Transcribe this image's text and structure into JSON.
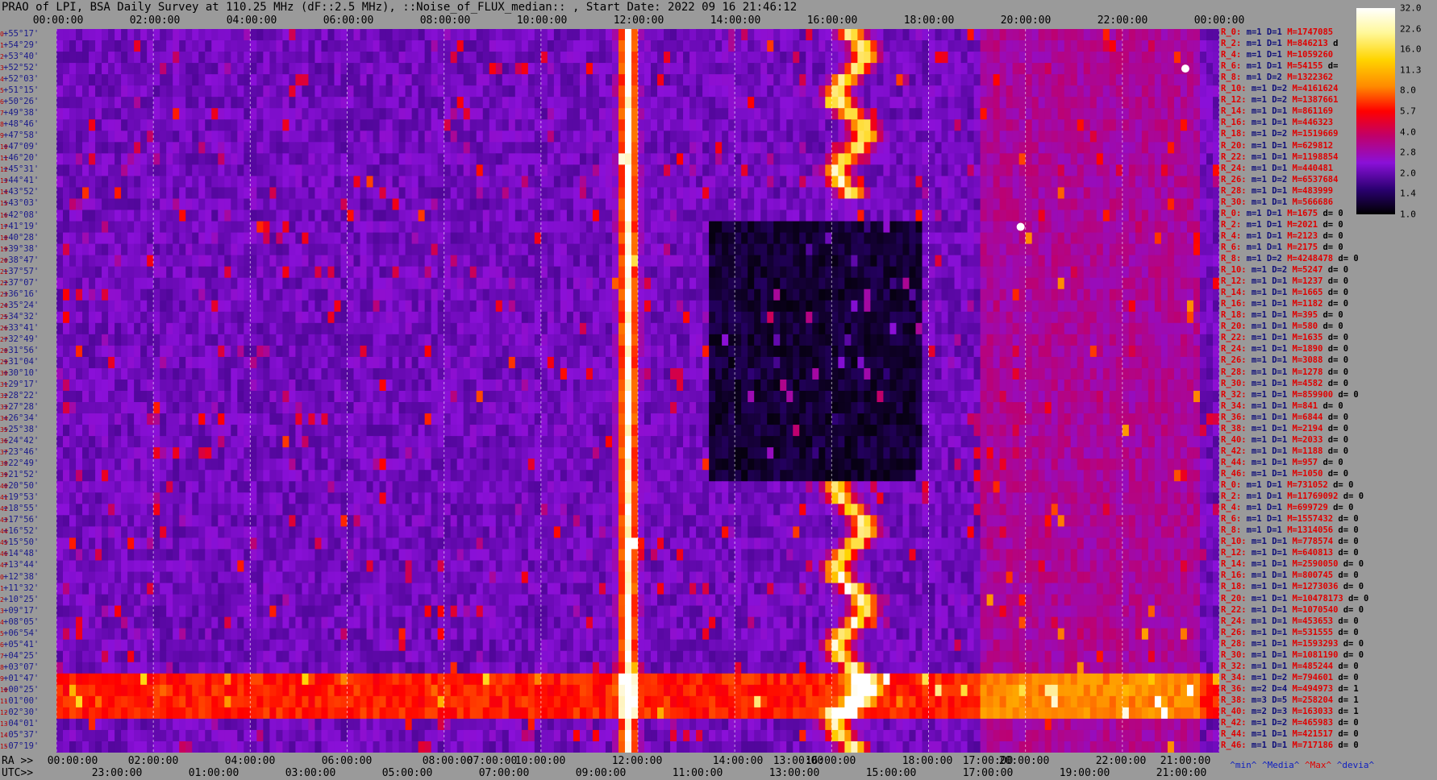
{
  "title": "PRAO of LPI, BSA Daily Survey at 110.25 MHz (dF::2.5 MHz), ::Noise_of_FLUX_median:: , Start Date: 2022 09 16 21:46:12",
  "top_ticks": [
    "00:00:00",
    "02:00:00",
    "04:00:00",
    "06:00:00",
    "08:00:00",
    "10:00:00",
    "12:00:00",
    "14:00:00",
    "16:00:00",
    "18:00:00",
    "20:00:00",
    "22:00:00",
    "00:00:00"
  ],
  "ra_label": "RA >>",
  "ra_ticks": [
    "00:00:00",
    "02:00:00",
    "04:00:00",
    "06:00:00",
    "08:00:00",
    "07:00:00",
    "10:00:00",
    "12:00:00",
    "14:00:00",
    "13:00:00",
    "16:00:00",
    "18:00:00",
    "17:00:00",
    "20:00:00",
    "22:00:00",
    "21:00:00"
  ],
  "utc_label": "UTC>>",
  "utc_ticks": [
    "23:00:00",
    "01:00:00",
    "03:00:00",
    "05:00:00",
    "07:00:00",
    "09:00:00",
    "11:00:00",
    "13:00:00",
    "15:00:00",
    "17:00:00",
    "19:00:00",
    "21:00:00"
  ],
  "dec_labels": [
    "+55°17'",
    "+54°29'",
    "+53°40'",
    "+52°52'",
    "+52°03'",
    "+51°15'",
    "+50°26'",
    "+49°38'",
    "+48°46'",
    "+47°58'",
    "+47°09'",
    "+46°20'",
    "+45°31'",
    "+44°41'",
    "+43°52'",
    "+43°03'",
    "+42°08'",
    "+41°19'",
    "+40°28'",
    "+39°38'",
    "+38°47'",
    "+37°57'",
    "+37°07'",
    "+36°16'",
    "+35°24'",
    "+34°32'",
    "+33°41'",
    "+32°49'",
    "+31°56'",
    "+31°04'",
    "+30°10'",
    "+29°17'",
    "+28°22'",
    "+27°28'",
    "+26°34'",
    "+25°38'",
    "+24°42'",
    "+23°46'",
    "+22°49'",
    "+21°52'",
    "+20°50'",
    "+19°53'",
    "+18°55'",
    "+17°56'",
    "+16°52'",
    "+15°50'",
    "+14°48'",
    "+13°44'",
    "+12°38'",
    "+11°32'",
    "+10°25'",
    "+09°17'",
    "+08°05'",
    "+06°54'",
    "+05°41'",
    "+04°25'",
    "+03°07'",
    "+01°47'",
    "+00°25'",
    "-01°00'",
    "-02°30'",
    "-04°01'",
    "-05°37'",
    "-07°19'"
  ],
  "stats": [
    {
      "r": "R_0:",
      "m": "m=1",
      "d": "D=1",
      "M": "M=1747085",
      "e": ""
    },
    {
      "r": "R_2:",
      "m": "m=1",
      "d": "D=1",
      "M": "M=846213",
      "e": "d"
    },
    {
      "r": "R_4:",
      "m": "m=1",
      "d": "D=1",
      "M": "M=1059260",
      "e": ""
    },
    {
      "r": "R_6:",
      "m": "m=1",
      "d": "D=1",
      "M": "M=54155",
      "e": "d="
    },
    {
      "r": "R_8:",
      "m": "m=1",
      "d": "D=2",
      "M": "M=1322362",
      "e": ""
    },
    {
      "r": "R_10:",
      "m": "m=1",
      "d": "D=2",
      "M": "M=4161624",
      "e": ""
    },
    {
      "r": "R_12:",
      "m": "m=1",
      "d": "D=2",
      "M": "M=1387661",
      "e": ""
    },
    {
      "r": "R_14:",
      "m": "m=1",
      "d": "D=1",
      "M": "M=861169",
      "e": ""
    },
    {
      "r": "R_16:",
      "m": "m=1",
      "d": "D=1",
      "M": "M=446323",
      "e": ""
    },
    {
      "r": "R_18:",
      "m": "m=1",
      "d": "D=2",
      "M": "M=1519669",
      "e": ""
    },
    {
      "r": "R_20:",
      "m": "m=1",
      "d": "D=1",
      "M": "M=629812",
      "e": ""
    },
    {
      "r": "R_22:",
      "m": "m=1",
      "d": "D=1",
      "M": "M=1198854",
      "e": ""
    },
    {
      "r": "R_24:",
      "m": "m=1",
      "d": "D=1",
      "M": "M=440481",
      "e": ""
    },
    {
      "r": "R_26:",
      "m": "m=1",
      "d": "D=2",
      "M": "M=6537684",
      "e": ""
    },
    {
      "r": "R_28:",
      "m": "m=1",
      "d": "D=1",
      "M": "M=483999",
      "e": ""
    },
    {
      "r": "R_30:",
      "m": "m=1",
      "d": "D=1",
      "M": "M=566686",
      "e": ""
    },
    {
      "r": "R_0:",
      "m": "m=1",
      "d": "D=1",
      "M": "M=1675",
      "e": "d= 0"
    },
    {
      "r": "R_2:",
      "m": "m=1",
      "d": "D=1",
      "M": "M=2021",
      "e": "d= 0"
    },
    {
      "r": "R_4:",
      "m": "m=1",
      "d": "D=1",
      "M": "M=2123",
      "e": "d= 0"
    },
    {
      "r": "R_6:",
      "m": "m=1",
      "d": "D=1",
      "M": "M=2175",
      "e": "d= 0"
    },
    {
      "r": "R_8:",
      "m": "m=1",
      "d": "D=2",
      "M": "M=4248478",
      "e": "d= 0"
    },
    {
      "r": "R_10:",
      "m": "m=1",
      "d": "D=2",
      "M": "M=5247",
      "e": "d= 0"
    },
    {
      "r": "R_12:",
      "m": "m=1",
      "d": "D=1",
      "M": "M=1237",
      "e": "d= 0"
    },
    {
      "r": "R_14:",
      "m": "m=1",
      "d": "D=1",
      "M": "M=1665",
      "e": "d= 0"
    },
    {
      "r": "R_16:",
      "m": "m=1",
      "d": "D=1",
      "M": "M=1182",
      "e": "d= 0"
    },
    {
      "r": "R_18:",
      "m": "m=1",
      "d": "D=1",
      "M": "M=395",
      "e": "d= 0"
    },
    {
      "r": "R_20:",
      "m": "m=1",
      "d": "D=1",
      "M": "M=580",
      "e": "d= 0"
    },
    {
      "r": "R_22:",
      "m": "m=1",
      "d": "D=1",
      "M": "M=1635",
      "e": "d= 0"
    },
    {
      "r": "R_24:",
      "m": "m=1",
      "d": "D=1",
      "M": "M=1890",
      "e": "d= 0"
    },
    {
      "r": "R_26:",
      "m": "m=1",
      "d": "D=1",
      "M": "M=3088",
      "e": "d= 0"
    },
    {
      "r": "R_28:",
      "m": "m=1",
      "d": "D=1",
      "M": "M=1278",
      "e": "d= 0"
    },
    {
      "r": "R_30:",
      "m": "m=1",
      "d": "D=1",
      "M": "M=4582",
      "e": "d= 0"
    },
    {
      "r": "R_32:",
      "m": "m=1",
      "d": "D=1",
      "M": "M=859900",
      "e": "d= 0"
    },
    {
      "r": "R_34:",
      "m": "m=1",
      "d": "D=1",
      "M": "M=841",
      "e": "d= 0"
    },
    {
      "r": "R_36:",
      "m": "m=1",
      "d": "D=1",
      "M": "M=6844",
      "e": "d= 0"
    },
    {
      "r": "R_38:",
      "m": "m=1",
      "d": "D=1",
      "M": "M=2194",
      "e": "d= 0"
    },
    {
      "r": "R_40:",
      "m": "m=1",
      "d": "D=1",
      "M": "M=2033",
      "e": "d= 0"
    },
    {
      "r": "R_42:",
      "m": "m=1",
      "d": "D=1",
      "M": "M=1188",
      "e": "d= 0"
    },
    {
      "r": "R_44:",
      "m": "m=1",
      "d": "D=1",
      "M": "M=957",
      "e": "d= 0"
    },
    {
      "r": "R_46:",
      "m": "m=1",
      "d": "D=1",
      "M": "M=1050",
      "e": "d= 0"
    },
    {
      "r": "R_0:",
      "m": "m=1",
      "d": "D=1",
      "M": "M=731052",
      "e": "d= 0"
    },
    {
      "r": "R_2:",
      "m": "m=1",
      "d": "D=1",
      "M": "M=11769092",
      "e": "d= 0"
    },
    {
      "r": "R_4:",
      "m": "m=1",
      "d": "D=1",
      "M": "M=699729",
      "e": "d= 0"
    },
    {
      "r": "R_6:",
      "m": "m=1",
      "d": "D=1",
      "M": "M=1557432",
      "e": "d= 0"
    },
    {
      "r": "R_8:",
      "m": "m=1",
      "d": "D=1",
      "M": "M=1314056",
      "e": "d= 0"
    },
    {
      "r": "R_10:",
      "m": "m=1",
      "d": "D=1",
      "M": "M=778574",
      "e": "d= 0"
    },
    {
      "r": "R_12:",
      "m": "m=1",
      "d": "D=1",
      "M": "M=640813",
      "e": "d= 0"
    },
    {
      "r": "R_14:",
      "m": "m=1",
      "d": "D=1",
      "M": "M=2590050",
      "e": "d= 0"
    },
    {
      "r": "R_16:",
      "m": "m=1",
      "d": "D=1",
      "M": "M=800745",
      "e": "d= 0"
    },
    {
      "r": "R_18:",
      "m": "m=1",
      "d": "D=1",
      "M": "M=1273036",
      "e": "d= 0"
    },
    {
      "r": "R_20:",
      "m": "m=1",
      "d": "D=1",
      "M": "M=10478173",
      "e": "d= 0"
    },
    {
      "r": "R_22:",
      "m": "m=1",
      "d": "D=1",
      "M": "M=1070540",
      "e": "d= 0"
    },
    {
      "r": "R_24:",
      "m": "m=1",
      "d": "D=1",
      "M": "M=453653",
      "e": "d= 0"
    },
    {
      "r": "R_26:",
      "m": "m=1",
      "d": "D=1",
      "M": "M=531555",
      "e": "d= 0"
    },
    {
      "r": "R_28:",
      "m": "m=1",
      "d": "D=1",
      "M": "M=1593293",
      "e": "d= 0"
    },
    {
      "r": "R_30:",
      "m": "m=1",
      "d": "D=1",
      "M": "M=1081190",
      "e": "d= 0"
    },
    {
      "r": "R_32:",
      "m": "m=1",
      "d": "D=1",
      "M": "M=485244",
      "e": "d= 0"
    },
    {
      "r": "R_34:",
      "m": "m=1",
      "d": "D=2",
      "M": "M=794601",
      "e": "d= 0"
    },
    {
      "r": "R_36:",
      "m": "m=2",
      "d": "D=4",
      "M": "M=494973",
      "e": "d= 1"
    },
    {
      "r": "R_38:",
      "m": "m=3",
      "d": "D=5",
      "M": "M=258204",
      "e": "d= 1"
    },
    {
      "r": "R_40:",
      "m": "m=2",
      "d": "D=3",
      "M": "M=163033",
      "e": "d= 1"
    },
    {
      "r": "R_42:",
      "m": "m=1",
      "d": "D=2",
      "M": "M=465983",
      "e": "d= 0"
    },
    {
      "r": "R_44:",
      "m": "m=1",
      "d": "D=1",
      "M": "M=421517",
      "e": "d= 0"
    },
    {
      "r": "R_46:",
      "m": "m=1",
      "d": "D=1",
      "M": "M=717186",
      "e": "d= 0"
    }
  ],
  "footer_legend": {
    "min": "^min^",
    "media": "^Media^",
    "max": "^Max^",
    "devia": "^devia^"
  },
  "colorbar": {
    "ticks": [
      "32.0",
      "22.6",
      "16.0",
      "11.3",
      "8.0",
      "5.7",
      "4.0",
      "2.8",
      "2.0",
      "1.4",
      "1.0"
    ],
    "colors": [
      "#ffffff",
      "#ffd400",
      "#ff8a00",
      "#ff0000",
      "#c0006a",
      "#8a10d8",
      "#2a0070",
      "#000000"
    ]
  },
  "chart_data": {
    "type": "heatmap",
    "title": "PRAO of LPI, BSA Daily Survey at 110.25 MHz (dF::2.5 MHz), ::Noise_of_FLUX_median:: , Start Date: 2022 09 16 21:46:12",
    "x_axis_top": [
      "00:00:00",
      "02:00:00",
      "04:00:00",
      "06:00:00",
      "08:00:00",
      "10:00:00",
      "12:00:00",
      "14:00:00",
      "16:00:00",
      "18:00:00",
      "20:00:00",
      "22:00:00",
      "00:00:00"
    ],
    "y_range_dec": [
      "+55°17'",
      "-07°19'"
    ],
    "n_beams": 64,
    "value_range": [
      1.0,
      32.0
    ],
    "colormap": [
      "#000000",
      "#2a0070",
      "#8a10d8",
      "#c0006a",
      "#ff0000",
      "#ff8a00",
      "#ffd400",
      "#ffffff"
    ],
    "features": [
      {
        "name": "bright vertical band",
        "x_hour": 11.8,
        "intensity": 32
      },
      {
        "name": "bright wandering band",
        "x_hour": 16.4,
        "intensity": 28
      },
      {
        "name": "horizontal band near equator",
        "dec": "+00°25'",
        "intensity": 12
      },
      {
        "name": "point source",
        "x_hour": 19.9,
        "dec": "+41°19'",
        "intensity": 32
      },
      {
        "name": "point source",
        "x_hour": 23.3,
        "dec": "+52°52'",
        "intensity": 20
      }
    ]
  }
}
